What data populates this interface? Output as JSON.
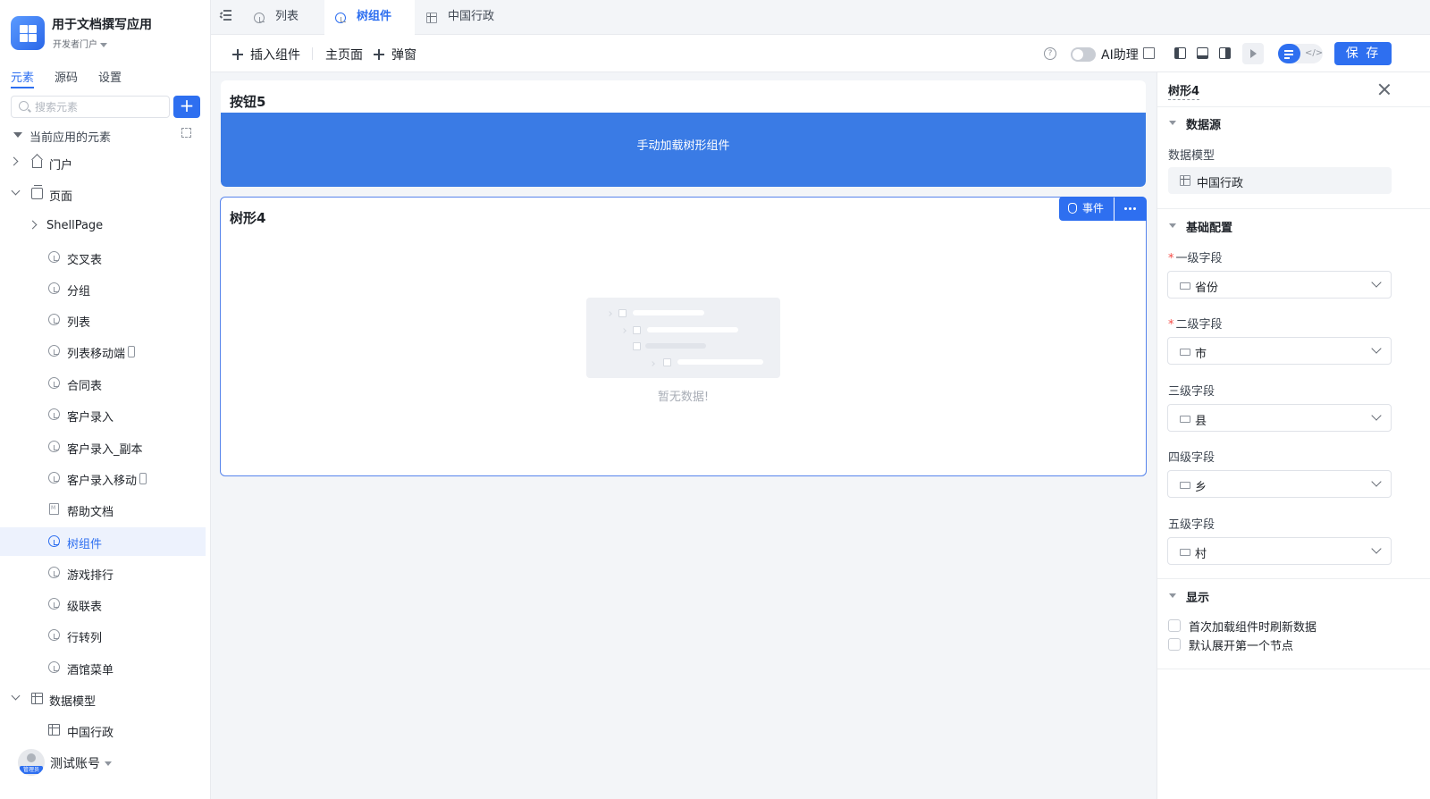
{
  "app": {
    "name": "用于文档撰写应用",
    "portal": "开发者门户",
    "brand_color": "#2e6ff0"
  },
  "sidebar": {
    "tabs": [
      {
        "label": "元素",
        "active": true
      },
      {
        "label": "源码",
        "active": false
      },
      {
        "label": "设置",
        "active": false
      }
    ],
    "search_placeholder": "搜索元素",
    "section_label": "当前应用的元素",
    "tree": [
      {
        "label": "门户",
        "icon": "home-icon",
        "expand": "collapsed"
      },
      {
        "label": "页面",
        "icon": "pages-icon",
        "expand": "expanded"
      },
      {
        "label": "ShellPage",
        "icon": "",
        "expand": "collapsed"
      },
      {
        "label": "交叉表",
        "icon": "page-icon"
      },
      {
        "label": "分组",
        "icon": "page-icon"
      },
      {
        "label": "列表",
        "icon": "page-icon"
      },
      {
        "label": "列表移动端",
        "icon": "page-icon",
        "mobile": true
      },
      {
        "label": "合同表",
        "icon": "page-icon"
      },
      {
        "label": "客户录入",
        "icon": "page-icon"
      },
      {
        "label": "客户录入_副本",
        "icon": "page-icon"
      },
      {
        "label": "客户录入移动",
        "icon": "page-icon",
        "mobile": true
      },
      {
        "label": "帮助文档",
        "icon": "doc-icon"
      },
      {
        "label": "树组件",
        "icon": "page-icon",
        "selected": true
      },
      {
        "label": "游戏排行",
        "icon": "page-icon"
      },
      {
        "label": "级联表",
        "icon": "page-icon"
      },
      {
        "label": "行转列",
        "icon": "page-icon"
      },
      {
        "label": "酒馆菜单",
        "icon": "page-icon"
      },
      {
        "label": "数据模型",
        "icon": "table-icon",
        "expand": "expanded"
      },
      {
        "label": "中国行政",
        "icon": "table-icon"
      }
    ],
    "account": {
      "name": "测试账号",
      "role_badge": "管理员"
    }
  },
  "top_tabs": [
    {
      "label": "列表",
      "icon": "page-icon",
      "active": false
    },
    {
      "label": "树组件",
      "icon": "page-icon",
      "active": true
    },
    {
      "label": "中国行政",
      "icon": "table-icon",
      "active": false
    }
  ],
  "toolbar": {
    "insert": "插入组件",
    "main_page": "主页面",
    "dialog": "弹窗",
    "ai_label": "AI助理",
    "ai_enabled": false,
    "save": "保 存"
  },
  "canvas": {
    "button_card": {
      "title": "按钮5",
      "button_label": "手动加载树形组件"
    },
    "tree_card": {
      "title": "树形4",
      "events": "事件",
      "empty_text": "暂无数据!"
    }
  },
  "props": {
    "title": "树形4",
    "datasource_section": "数据源",
    "model_label": "数据模型",
    "model_value": "中国行政",
    "basic_section": "基础配置",
    "fields": [
      {
        "label": "一级字段",
        "required": true,
        "value": "省份"
      },
      {
        "label": "二级字段",
        "required": true,
        "value": "市"
      },
      {
        "label": "三级字段",
        "required": false,
        "value": "县"
      },
      {
        "label": "四级字段",
        "required": false,
        "value": "乡"
      },
      {
        "label": "五级字段",
        "required": false,
        "value": "村"
      }
    ],
    "display_section": "显示",
    "checkboxes": [
      {
        "label": "首次加载组件时刷新数据",
        "checked": false
      },
      {
        "label": "默认展开第一个节点",
        "checked": false
      }
    ]
  }
}
